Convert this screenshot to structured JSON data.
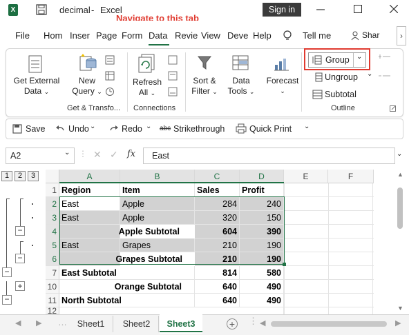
{
  "window": {
    "file_name": "decimal",
    "separator": "-",
    "app_name": "Excel",
    "sign_in_label": "Sign in"
  },
  "annotation": {
    "text": "Navigate to this tab",
    "color": "#e03a2f"
  },
  "menu": {
    "items": [
      "File",
      "Hom",
      "Inser",
      "Page",
      "Form",
      "Data",
      "Revie",
      "View",
      "Deve",
      "Help"
    ],
    "tell_me": "Tell me",
    "share": "Shar"
  },
  "ribbon": {
    "get_external_data": [
      "Get External",
      "Data"
    ],
    "new_query": [
      "New",
      "Query"
    ],
    "refresh_all": [
      "Refresh",
      "All"
    ],
    "sort_filter": [
      "Sort &",
      "Filter"
    ],
    "data_tools": [
      "Data",
      "Tools"
    ],
    "forecast": "Forecast",
    "group": "Group",
    "ungroup": "Ungroup",
    "subtotal": "Subtotal",
    "groups": {
      "get_transform": "Get & Transfo...",
      "connections": "Connections",
      "outline": "Outline"
    }
  },
  "qat": {
    "save": "Save",
    "undo": "Undo",
    "redo": "Redo",
    "strikethrough": "Strikethrough",
    "quick_print": "Quick Print"
  },
  "formula_bar": {
    "name_box": "A2",
    "fx": "fx",
    "value": "East"
  },
  "outline_levels": [
    "1",
    "2",
    "3"
  ],
  "sheet": {
    "columns": [
      "A",
      "B",
      "C",
      "D",
      "E",
      "F"
    ],
    "rows": [
      {
        "n": "1",
        "a": "Region",
        "b": "Item",
        "c": "Sales",
        "d": "Profit"
      },
      {
        "n": "2",
        "a": "East",
        "b": "Apple",
        "c": "284",
        "d": "240"
      },
      {
        "n": "3",
        "a": "East",
        "b": "Apple",
        "c": "320",
        "d": "150"
      },
      {
        "n": "4",
        "a": "",
        "b": "Apple Subtotal",
        "c": "604",
        "d": "390"
      },
      {
        "n": "5",
        "a": "East",
        "b": "Grapes",
        "c": "210",
        "d": "190"
      },
      {
        "n": "6",
        "a": "",
        "b": "Grapes Subtotal",
        "c": "210",
        "d": "190"
      },
      {
        "n": "7",
        "a": "East Subtotal",
        "b": "",
        "c": "814",
        "d": "580"
      },
      {
        "n": "10",
        "a": "",
        "b": "Orange Subtotal",
        "c": "640",
        "d": "490"
      },
      {
        "n": "11",
        "a": "North Subtotal",
        "b": "",
        "c": "640",
        "d": "490"
      },
      {
        "n": "12",
        "a": "",
        "b": "",
        "c": "",
        "d": ""
      }
    ]
  },
  "tabs": [
    "Sheet1",
    "Sheet2",
    "Sheet3"
  ],
  "colors": {
    "accent_green": "#217346",
    "highlight": "#e03a2f",
    "selection": "#d2d2d2"
  }
}
